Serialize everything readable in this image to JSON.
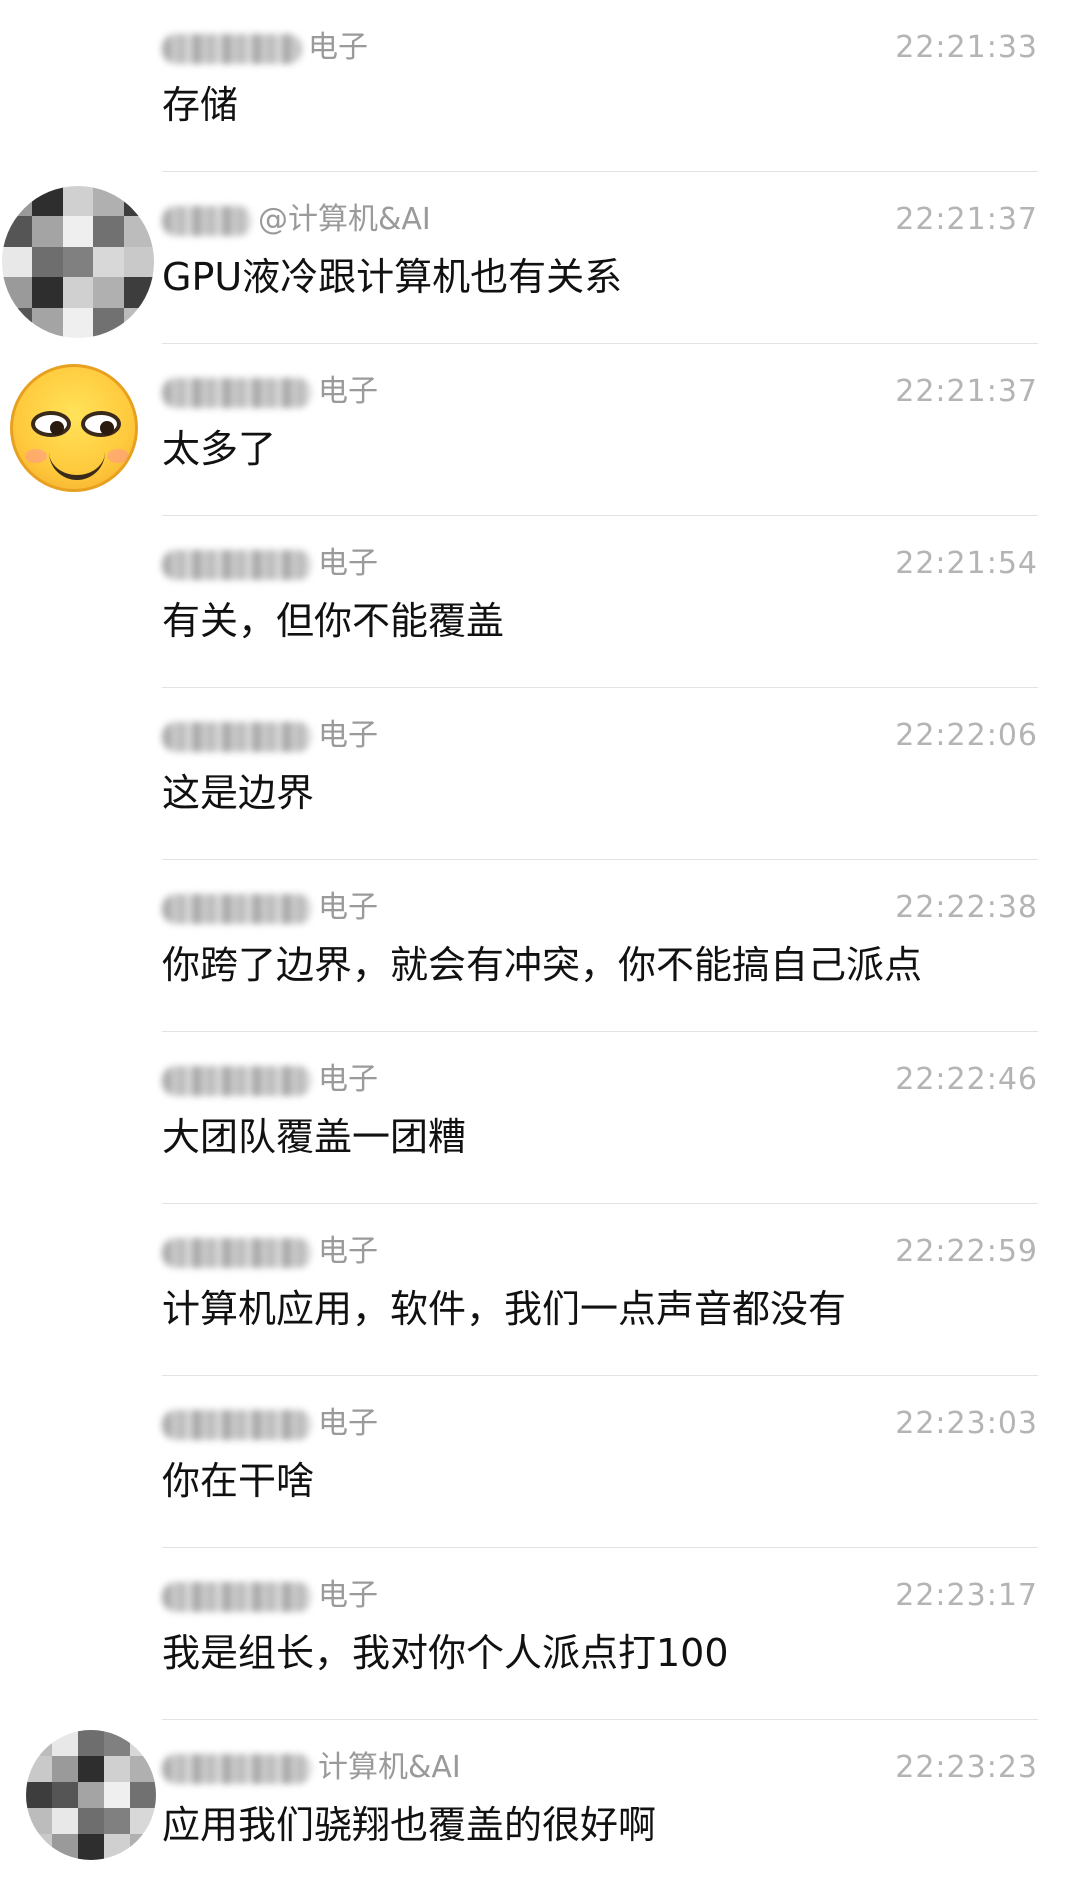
{
  "messages": [
    {
      "sender": "电子",
      "time": "22:21:33",
      "text": "存储"
    },
    {
      "sender": "@计算机&AI",
      "time": "22:21:37",
      "text": "GPU液冷跟计算机也有关系"
    },
    {
      "sender": "电子",
      "time": "22:21:37",
      "text": "太多了"
    },
    {
      "sender": "电子",
      "time": "22:21:54",
      "text": "有关，但你不能覆盖"
    },
    {
      "sender": "电子",
      "time": "22:22:06",
      "text": "这是边界"
    },
    {
      "sender": "电子",
      "time": "22:22:38",
      "text": "你跨了边界，就会有冲突，你不能搞自己派点"
    },
    {
      "sender": "电子",
      "time": "22:22:46",
      "text": "大团队覆盖一团糟"
    },
    {
      "sender": "电子",
      "time": "22:22:59",
      "text": "计算机应用，软件，我们一点声音都没有"
    },
    {
      "sender": "电子",
      "time": "22:23:03",
      "text": "你在干啥"
    },
    {
      "sender": "电子",
      "time": "22:23:17",
      "text": "我是组长，我对你个人派点打100"
    },
    {
      "sender": "计算机&AI",
      "time": "22:23:23",
      "text": "应用我们骁翔也覆盖的很好啊"
    }
  ],
  "avatars": {
    "mosaic_colors": [
      "#9a9a9a",
      "#d8d8d8",
      "#6e6e6e",
      "#bcbcbc",
      "#efefef",
      "#555555",
      "#b0b0b0",
      "#2e2e2e",
      "#c9c9c9",
      "#808080",
      "#e8e8e8",
      "#717171",
      "#a4a4a4",
      "#3d3d3d",
      "#d0d0d0"
    ],
    "emoji_icon": "smirk-face-icon"
  }
}
